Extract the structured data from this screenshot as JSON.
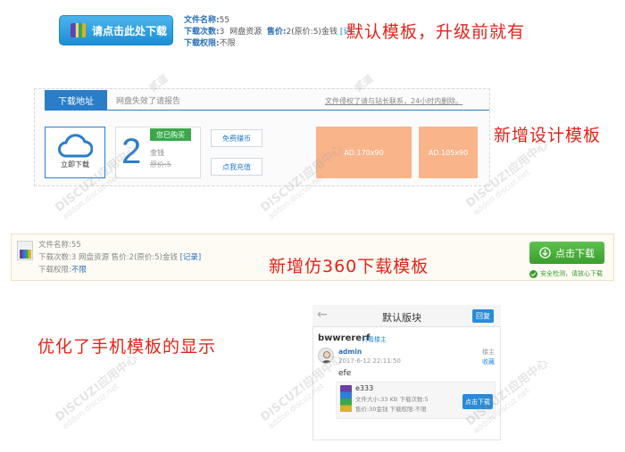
{
  "section1": {
    "download_button": "请点击此处下载",
    "file_name_label": "文件名称:",
    "file_name_value": "55",
    "downloads_label": "下载次数:",
    "downloads_value": "3",
    "source": "网盘资源",
    "price_label": "售价:",
    "price_value": "2(原价:5)金钱",
    "price_link": "[记",
    "permission_label": "下载权限:",
    "permission_value": "不限",
    "caption": "默认模板，升级前就有"
  },
  "section2": {
    "tab_active": "下载地址",
    "tab_inactive": "网盘失效了请报告",
    "contact": "文件侵权了请与站长联系，24小时内删除。",
    "cloud_label": "立即下载",
    "big_number": "2",
    "bought_badge": "您已购买",
    "unit": "金钱",
    "original_price": "原价:5",
    "free_coins_button": "免费赚币",
    "recharge_button": "点我充值",
    "ad1": "AD.170x90",
    "ad2": "AD.105x90",
    "caption": "新增设计模板"
  },
  "section3": {
    "file_name": "文件名称:55",
    "details": "下载次数:3  网盘资源  售价:2(原价:5)金钱",
    "record_link": "[记录]",
    "permission_label": "下载权限:",
    "permission_value": "不限",
    "caption": "新增仿360下载模板",
    "download_button": "点击下载",
    "safe_text": "安全检测，请放心下载"
  },
  "section4": {
    "caption": "优化了手机模板的显示",
    "header_title": "默认版块",
    "reply_button": "回复",
    "thread_title": "bwwrererf",
    "only_author": "只看楼主",
    "author": "admin",
    "datetime": "2017-6-12 22:11:50",
    "floor": "楼主",
    "favorite": "收藏",
    "content": "efe",
    "attach_name": "e333",
    "attach_size": "文件大小:33 KB   下载次数:5",
    "attach_price": "售价:30金钱   下载权限:不限",
    "attach_download": "点击下载"
  },
  "watermark": {
    "brand": "DISCUZ!应用中心",
    "alt": "贰道",
    "domain": "addon.discuz.net"
  },
  "colors": {
    "caption_red": "#e2231a",
    "primary_blue": "#2a7dc8",
    "success_green": "#3a9e2c",
    "ad_orange": "#f9b48a"
  }
}
